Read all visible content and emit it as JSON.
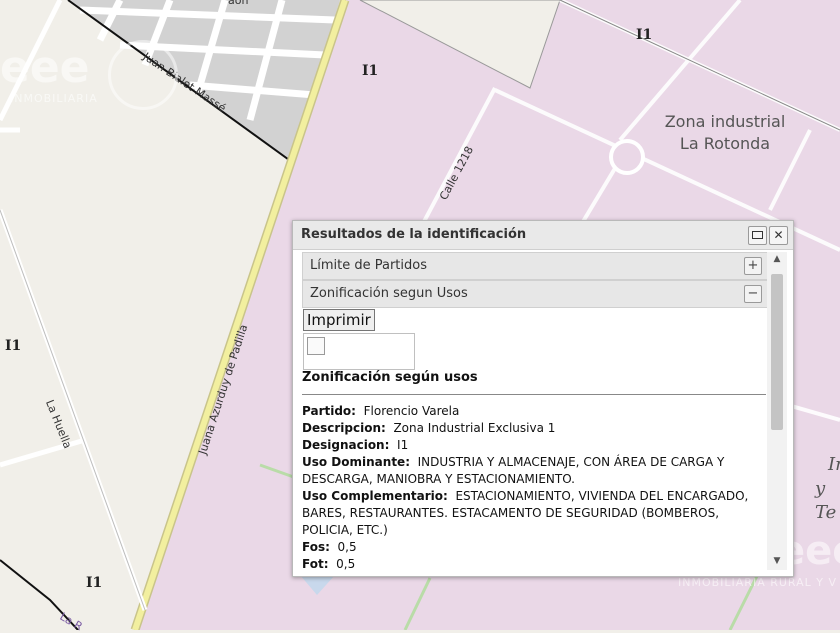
{
  "map": {
    "zone_codes": [
      "I1",
      "I1",
      "I1",
      "I1"
    ],
    "streets": [
      "Juan Bialet Massé",
      "Calle 1218",
      "Juana Azurduy de Padilla",
      "La Huella",
      "La R",
      "aon"
    ],
    "zone_name": [
      "Zona industrial",
      "La Rotonda"
    ],
    "edge_text": [
      "In",
      "y Te"
    ],
    "colors": {
      "base": "#f1efe9",
      "zone_pink": "#ead8e7",
      "road_yellow": "#f2ef9f",
      "blocks": "#cfcfcf"
    }
  },
  "watermark": {
    "left_text": "eee",
    "left_sub": "INMOBILIARIA",
    "right_text": "eee",
    "right_sub": "INMOBILIARIA RURAL Y V"
  },
  "popup": {
    "title": "Resultados de la identificación",
    "sections": [
      {
        "label": "Límite de Partidos",
        "toggle": "+"
      },
      {
        "label": "Zonificación segun Usos",
        "toggle": "−"
      }
    ],
    "print_label": "Imprimir",
    "section_title": "Zonificación según usos",
    "fields": [
      {
        "label": "Partido:",
        "value": "Florencio Varela"
      },
      {
        "label": "Descripcion:",
        "value": "Zona Industrial Exclusiva 1"
      },
      {
        "label": "Designacion:",
        "value": "I1"
      },
      {
        "label": "Uso Dominante:",
        "value": "INDUSTRIA Y ALMACENAJE, CON ÁREA DE CARGA Y DESCARGA, MANIOBRA Y ESTACIONAMIENTO."
      },
      {
        "label": "Uso Complementario:",
        "value": "ESTACIONAMIENTO, VIVIENDA DEL ENCARGADO, BARES, RESTAURANTES. ESTACAMENTO DE SEGURIDAD (BOMBEROS, POLICIA, ETC.)"
      },
      {
        "label": "Fos:",
        "value": "0,5"
      },
      {
        "label": "Fot:",
        "value": "0,5"
      }
    ]
  }
}
